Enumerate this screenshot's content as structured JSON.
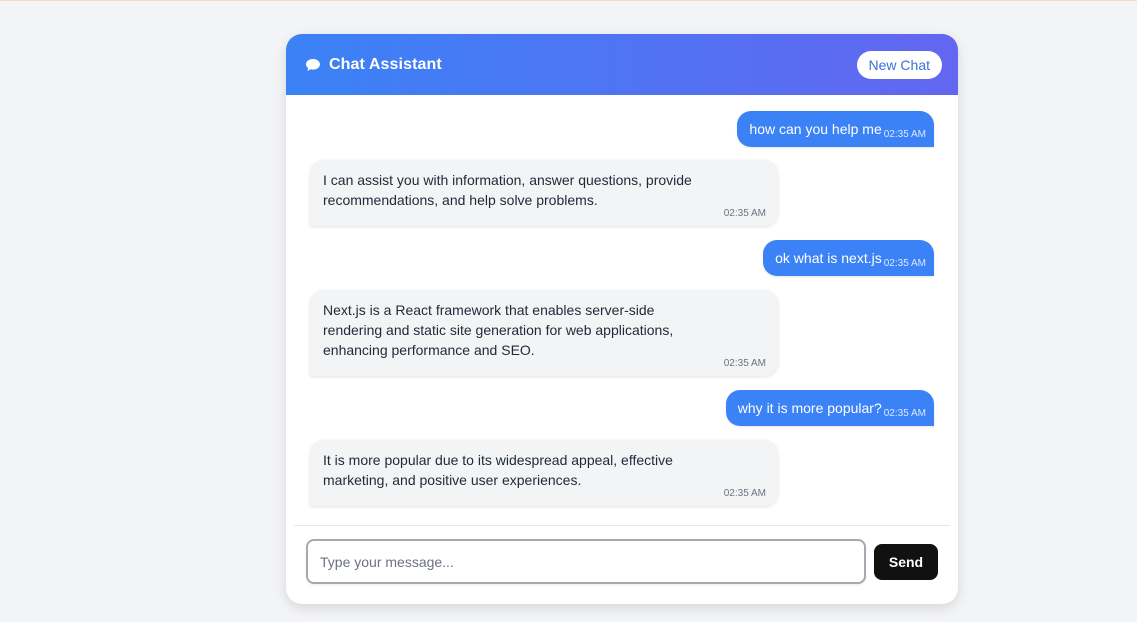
{
  "header": {
    "title": "Chat Assistant",
    "new_chat_label": "New Chat",
    "icon": "chat-bubble-icon"
  },
  "messages": [
    {
      "role": "user",
      "text": "how can you help me",
      "time": "02:35 AM"
    },
    {
      "role": "bot",
      "text": "I can assist you with information, answer questions, provide recommendations, and help solve problems.",
      "time": "02:35 AM"
    },
    {
      "role": "user",
      "text": "ok what is next.js",
      "time": "02:35 AM"
    },
    {
      "role": "bot",
      "text": "Next.js is a React framework that enables server-side rendering and static site generation for web applications, enhancing performance and SEO.",
      "time": "02:35 AM"
    },
    {
      "role": "user",
      "text": "why it is more popular?",
      "time": "02:35 AM"
    },
    {
      "role": "bot",
      "text": "It is more popular due to its widespread appeal, effective marketing, and positive user experiences.",
      "time": "02:35 AM"
    }
  ],
  "composer": {
    "placeholder": "Type your message...",
    "value": "",
    "send_label": "Send"
  },
  "colors": {
    "header_gradient_start": "#3b82f6",
    "header_gradient_end": "#6366f1",
    "user_bubble": "#3b82f6",
    "bot_bubble": "#f3f4f6",
    "send_button": "#111111"
  }
}
